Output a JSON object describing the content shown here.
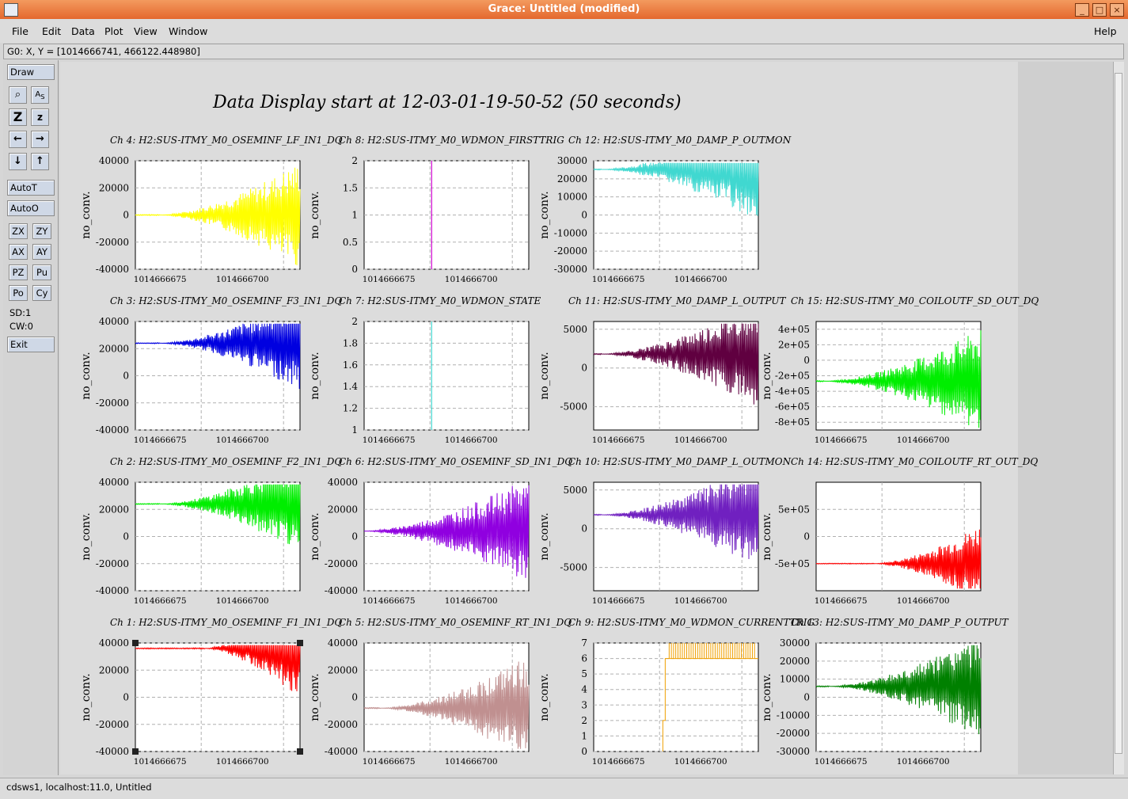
{
  "window": {
    "title": "Grace: Untitled (modified)"
  },
  "menu": [
    "File",
    "Edit",
    "Data",
    "Plot",
    "View",
    "Window"
  ],
  "help": "Help",
  "locator": "G0: X, Y = [1014666741, 466122.448980]",
  "tools": {
    "draw": "Draw",
    "autot": "AutoT",
    "autoo": "AutoO",
    "zx": "ZX",
    "zy": "ZY",
    "ax": "AX",
    "ay": "AY",
    "pz": "PZ",
    "pu": "Pu",
    "po": "Po",
    "cy": "Cy",
    "sd": "SD:1",
    "cw": "CW:0",
    "exit": "Exit",
    "icons": [
      "magnify-icon",
      "text-autoscale-icon",
      "zoom-in-icon",
      "zoom-out-icon",
      "left-arrow-icon",
      "right-arrow-icon",
      "down-arrow-icon",
      "up-arrow-icon"
    ]
  },
  "status": "cdsws1, localhost:11.0, Untitled",
  "page_title": "Data Display start at 12-03-01-19-50-52 (50 seconds)",
  "ylabel": "no_conv.",
  "xticks": [
    "1014666675",
    "1014666700"
  ],
  "chart_data": [
    {
      "type": "line",
      "title": "Ch 4: H2:SUS-ITMY_M0_OSEMINF_LF_IN1_DQ",
      "color": "#ffff00",
      "ylim": [
        -40000,
        40000
      ],
      "yticks": [
        "40000",
        "20000",
        "0",
        "-20000",
        "-40000"
      ],
      "shape": "grow",
      "start": 0.15,
      "amp": 0.62,
      "center": 0.15
    },
    {
      "type": "line",
      "title": "Ch 8: H2:SUS-ITMY_M0_WDMON_FIRSTTRIG",
      "color": "#d000d0",
      "ylim": [
        0,
        2
      ],
      "yticks": [
        "2",
        "1.5",
        "1",
        "0.5",
        "0"
      ],
      "shape": "step",
      "stepAt": 0.41,
      "low": 0,
      "high": 2
    },
    {
      "type": "line",
      "title": "Ch 12: H2:SUS-ITMY_M0_DAMP_P_OUTMON",
      "color": "#40d8d0",
      "ylim": [
        -30000,
        30000
      ],
      "yticks": [
        "30000",
        "20000",
        "10000",
        "0",
        "-10000",
        "-20000",
        "-30000"
      ],
      "shape": "grow",
      "start": 0.05,
      "amp": 0.6,
      "center": 0,
      "mid": 0.08
    },
    null,
    {
      "type": "line",
      "title": "Ch 3: H2:SUS-ITMY_M0_OSEMINF_F3_IN1_DQ",
      "color": "#0000e0",
      "ylim": [
        -40000,
        40000
      ],
      "yticks": [
        "40000",
        "20000",
        "0",
        "-20000",
        "-40000"
      ],
      "shape": "grow",
      "start": 0.15,
      "amp": 0.55,
      "center": 0.15,
      "mid": 0.2
    },
    {
      "type": "line",
      "title": "Ch 7: H2:SUS-ITMY_M0_WDMON_STATE",
      "color": "#40d8d0",
      "ylim": [
        1,
        2
      ],
      "yticks": [
        "2",
        "1.8",
        "1.6",
        "1.4",
        "1.2",
        "1"
      ],
      "shape": "step",
      "stepAt": 0.41,
      "low": 1,
      "high": 2
    },
    {
      "type": "line",
      "title": "Ch 11: H2:SUS-ITMY_M0_DAMP_L_OUTPUT",
      "color": "#600040",
      "ylim": [
        -8000,
        6000
      ],
      "yticks": [
        "5000",
        "0",
        "-5000"
      ],
      "ytickvals": [
        5000,
        0,
        -5000
      ],
      "shape": "grow",
      "start": 0.05,
      "amp": 0.62,
      "center": 0.07,
      "mid": 0.3
    },
    {
      "type": "line",
      "title": "Ch 15: H2:SUS-ITMY_M0_COILOUTF_SD_OUT_DQ",
      "color": "#00ee00",
      "ylim": [
        -900000,
        500000
      ],
      "yticks": [
        "4e+05",
        "2e+05",
        "0",
        "-2e+05",
        "-4e+05",
        "-6e+05",
        "-8e+05"
      ],
      "ytickvals": [
        400000,
        200000,
        0,
        -200000,
        -400000,
        -600000,
        -800000
      ],
      "shape": "grow",
      "start": 0.05,
      "amp": 0.6,
      "center": 0.07,
      "mid": 0.55
    },
    {
      "type": "line",
      "title": "Ch 2: H2:SUS-ITMY_M0_OSEMINF_F2_IN1_DQ",
      "color": "#00ee00",
      "ylim": [
        -40000,
        40000
      ],
      "yticks": [
        "40000",
        "20000",
        "0",
        "-20000",
        "-40000"
      ],
      "shape": "grow",
      "start": 0.15,
      "amp": 0.55,
      "center": 0.15,
      "mid": 0.2
    },
    {
      "type": "line",
      "title": "Ch 6: H2:SUS-ITMY_M0_OSEMINF_SD_IN1_DQ",
      "color": "#9000e0",
      "ylim": [
        -40000,
        40000
      ],
      "yticks": [
        "40000",
        "20000",
        "0",
        "-20000",
        "-40000"
      ],
      "shape": "grow",
      "start": 0.0,
      "amp": 0.62,
      "center": 0.15,
      "mid": 0.45
    },
    {
      "type": "line",
      "title": "Ch 10: H2:SUS-ITMY_M0_DAMP_L_OUTMON",
      "color": "#7020c0",
      "ylim": [
        -8000,
        6000
      ],
      "yticks": [
        "5000",
        "0",
        "-5000"
      ],
      "ytickvals": [
        5000,
        0,
        -5000
      ],
      "shape": "grow",
      "start": 0.05,
      "amp": 0.62,
      "center": 0.07,
      "mid": 0.3
    },
    {
      "type": "line",
      "title": "Ch 14: H2:SUS-ITMY_M0_COILOUTF_RT_OUT_DQ",
      "color": "#ff0000",
      "ylim": [
        -1000000,
        1000000
      ],
      "yticks": [
        "5e+05",
        "0",
        "-5e+05"
      ],
      "ytickvals": [
        500000,
        0,
        -500000
      ],
      "shape": "grow",
      "start": 0.35,
      "amp": 0.45,
      "center": 0,
      "mid": 0.75
    },
    {
      "type": "line",
      "title": "Ch 1: H2:SUS-ITMY_M0_OSEMINF_F1_IN1_DQ",
      "color": "#ff0000",
      "ylim": [
        -40000,
        40000
      ],
      "yticks": [
        "40000",
        "20000",
        "0",
        "-20000",
        "-40000"
      ],
      "shape": "grow",
      "start": 0.42,
      "amp": 0.62,
      "center": 0.15,
      "mid": 0.05,
      "selected": true
    },
    {
      "type": "line",
      "title": "Ch 5: H2:SUS-ITMY_M0_OSEMINF_RT_IN1_DQ",
      "color": "#c09090",
      "ylim": [
        -40000,
        40000
      ],
      "yticks": [
        "40000",
        "20000",
        "0",
        "-20000",
        "-40000"
      ],
      "shape": "grow",
      "start": 0.1,
      "amp": 0.6,
      "center": 0.15,
      "mid": 0.6
    },
    {
      "type": "line",
      "title": "Ch 9: H2:SUS-ITMY_M0_WDMON_CURRENTTRIG",
      "color": "#f0a000",
      "ylim": [
        0,
        7
      ],
      "yticks": [
        "7",
        "6",
        "5",
        "4",
        "3",
        "2",
        "1",
        "0"
      ],
      "shape": "trig",
      "stepAt": 0.42
    },
    {
      "type": "line",
      "title": "Ch 13: H2:SUS-ITMY_M0_DAMP_P_OUTPUT",
      "color": "#008000",
      "ylim": [
        -30000,
        30000
      ],
      "yticks": [
        "30000",
        "20000",
        "10000",
        "0",
        "-10000",
        "-20000",
        "-30000"
      ],
      "shape": "grow",
      "start": 0.08,
      "amp": 0.6,
      "center": 0,
      "mid": 0.4
    }
  ]
}
